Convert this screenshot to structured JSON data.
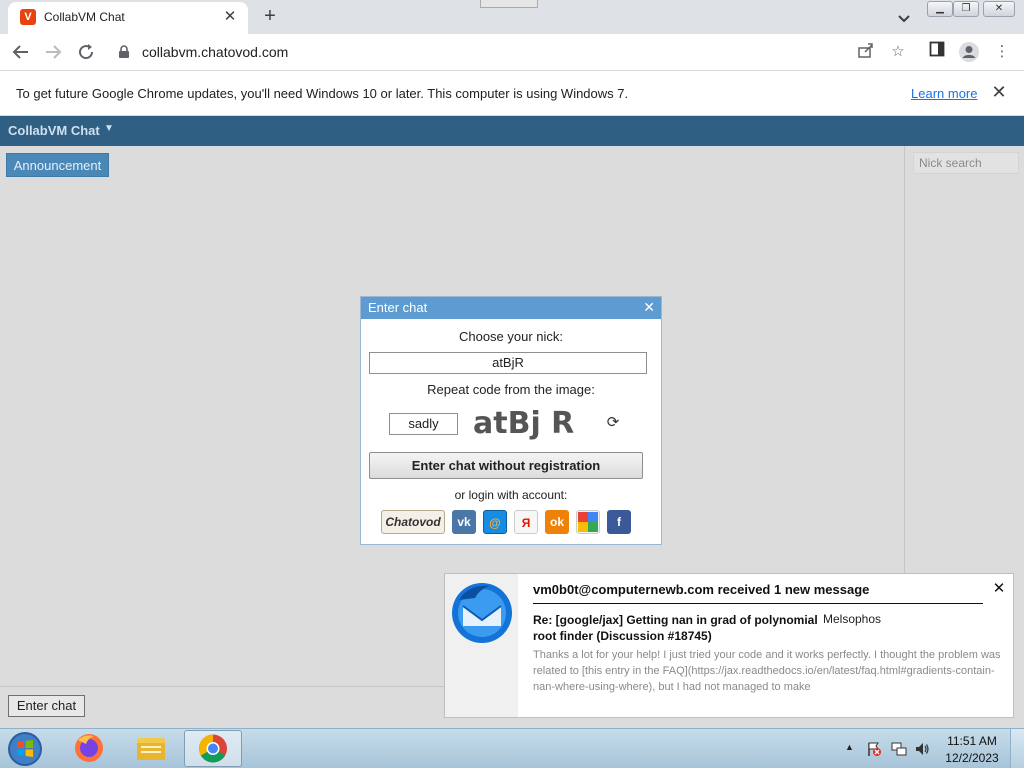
{
  "browser": {
    "tab_title": "CollabVM Chat",
    "tab_favicon": "V",
    "tab_close_glyph": "✕",
    "new_tab_glyph": "+",
    "url": "collabvm.chatovod.com"
  },
  "infobar": {
    "message": "To get future Google Chrome updates, you'll need Windows 10 or later. This computer is using Windows 7.",
    "learn_more": "Learn more",
    "close_glyph": "✕"
  },
  "app": {
    "title": "CollabVM Chat",
    "title_caret": "▼",
    "announcement_button": "Announcement",
    "nick_search_placeholder": "Nick search",
    "enter_chat_button": "Enter chat"
  },
  "modal": {
    "title": "Enter chat",
    "close_glyph": "✕",
    "choose_nick_label": "Choose your nick:",
    "nick_value": "atBjR",
    "repeat_code_label": "Repeat code from the image:",
    "captcha_value": "sadly",
    "captcha_text": "atBj R",
    "refresh_glyph": "⟳",
    "enter_without_registration": "Enter chat without registration",
    "or_login_label": "or login with account:",
    "social": [
      {
        "name": "Chatovod",
        "glyph": "Chatovod"
      },
      {
        "name": "vk",
        "glyph": "vk"
      },
      {
        "name": "mail",
        "glyph": "@"
      },
      {
        "name": "yandex",
        "glyph": "Я"
      },
      {
        "name": "odnoklassniki",
        "glyph": "ok"
      },
      {
        "name": "google",
        "glyph": ""
      },
      {
        "name": "facebook",
        "glyph": "f"
      }
    ]
  },
  "notification": {
    "title": "vm0b0t@computernewb.com received 1 new message",
    "close_glyph": "✕",
    "subject": "Re: [google/jax] Getting nan in grad of polynomial root finder (Discussion #18745)",
    "sender": "Melsophos",
    "preview": "Thanks a lot for your help! I just tried your code and it works perfectly. I thought the problem was related to [this entry in the FAQ](https://jax.readthedocs.io/en/latest/faq.html#gradients-contain-nan-where-using-where), but I had not managed to make"
  },
  "taskbar": {
    "time": "11:51 AM",
    "date": "12/2/2023",
    "tray_arrow": "▲"
  },
  "colors": {
    "app_header": "#2f5f82",
    "modal_header": "#5d9bd1",
    "announcement_button": "#4a88b8",
    "link": "#1a73e8"
  }
}
